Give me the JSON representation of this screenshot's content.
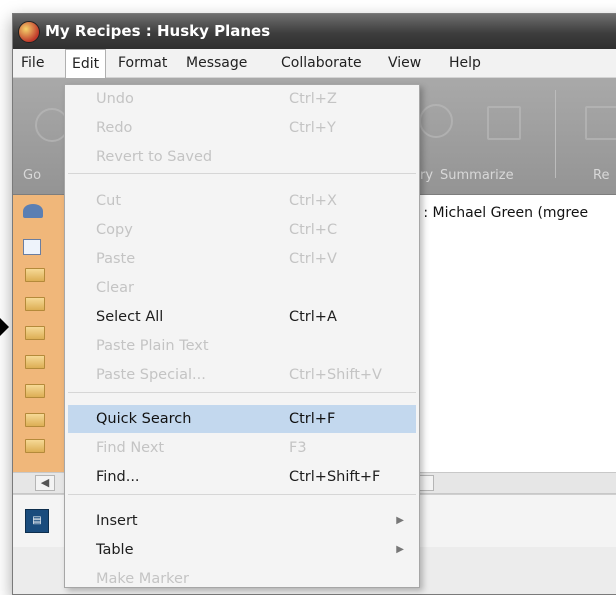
{
  "window": {
    "title": "My Recipes : Husky Planes"
  },
  "menubar": [
    "File",
    "Edit",
    "Format",
    "Message",
    "Collaborate",
    "View",
    "Help"
  ],
  "toolbar": {
    "labels": [
      "Go",
      "ry",
      "Summarize",
      "Re"
    ]
  },
  "content": {
    "header": "es : Michael Green (mgree"
  },
  "edit_menu": {
    "items": [
      {
        "label": "Undo",
        "shortcut": "Ctrl+Z",
        "enabled": false
      },
      {
        "label": "Redo",
        "shortcut": "Ctrl+Y",
        "enabled": false
      },
      {
        "label": "Revert to Saved",
        "shortcut": "",
        "enabled": false
      },
      {
        "label": "Cut",
        "shortcut": "Ctrl+X",
        "enabled": false
      },
      {
        "label": "Copy",
        "shortcut": "Ctrl+C",
        "enabled": false
      },
      {
        "label": "Paste",
        "shortcut": "Ctrl+V",
        "enabled": false
      },
      {
        "label": "Clear",
        "shortcut": "",
        "enabled": false
      },
      {
        "label": "Select All",
        "shortcut": "Ctrl+A",
        "enabled": true
      },
      {
        "label": "Paste Plain Text",
        "shortcut": "",
        "enabled": false
      },
      {
        "label": "Paste Special...",
        "shortcut": "Ctrl+Shift+V",
        "enabled": false
      },
      {
        "label": "Quick Search",
        "shortcut": "Ctrl+F",
        "enabled": true,
        "highlighted": true
      },
      {
        "label": "Find Next",
        "shortcut": "F3",
        "enabled": false
      },
      {
        "label": "Find...",
        "shortcut": "Ctrl+Shift+F",
        "enabled": true
      },
      {
        "label": "Insert",
        "shortcut": "",
        "enabled": true,
        "submenu": true
      },
      {
        "label": "Table",
        "shortcut": "",
        "enabled": true,
        "submenu": true
      },
      {
        "label": "Make Marker",
        "shortcut": "",
        "enabled": false
      }
    ]
  },
  "colors": {
    "highlight": "#c3d8ee",
    "folder_pane": "#f0b77a",
    "titlebar": "#3d3d3d"
  }
}
